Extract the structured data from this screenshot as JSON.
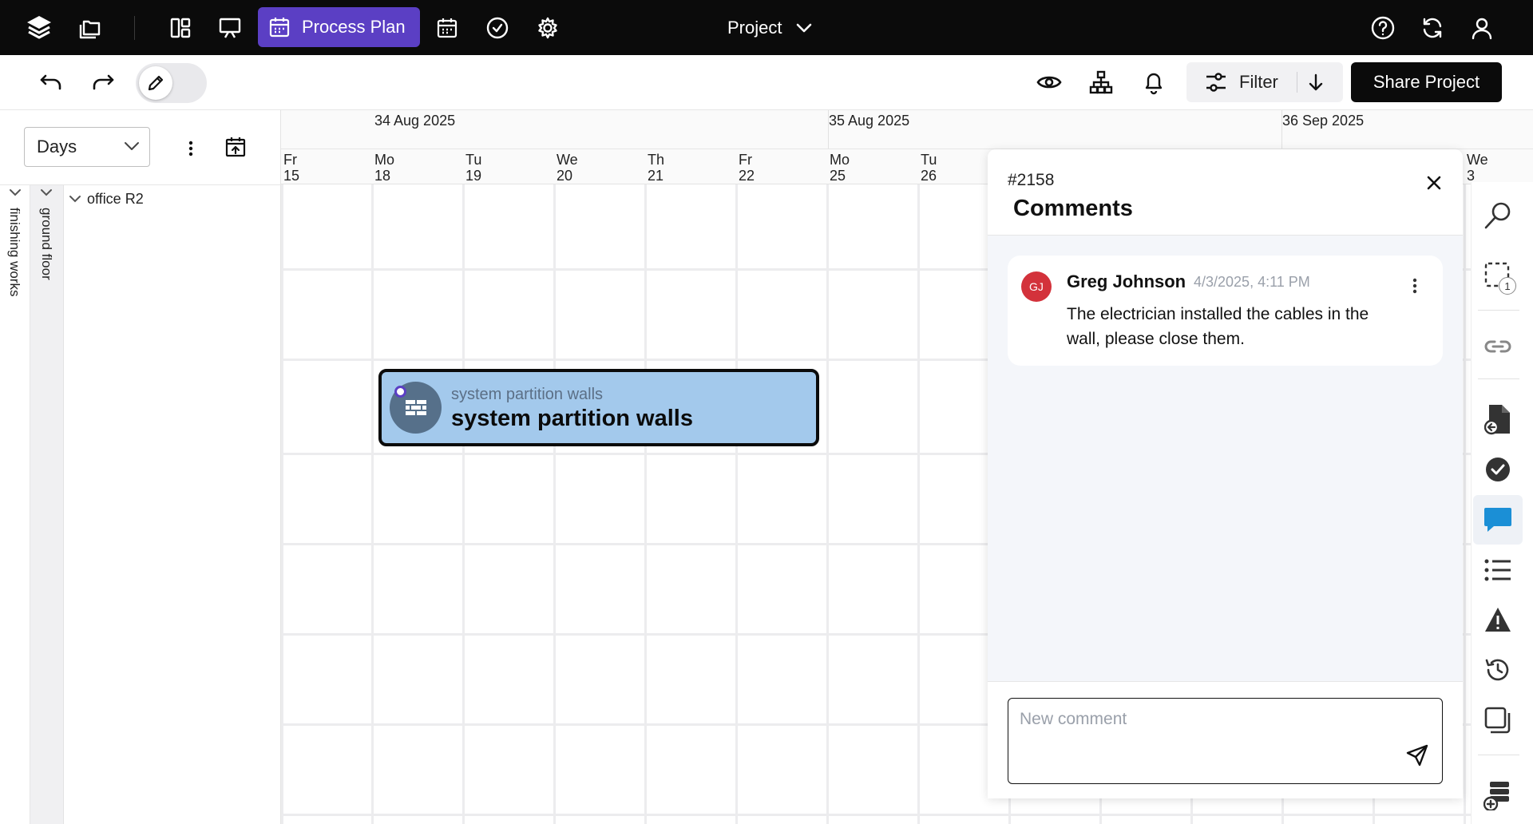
{
  "topbar": {
    "icons": [
      "layers-icon",
      "folders-icon",
      "dashboard-icon",
      "presentation-icon"
    ],
    "active_tab": {
      "label": "Process Plan",
      "icon": "calendar-icon"
    },
    "more_icons": [
      "calendar-icon",
      "check-circle-icon",
      "gear-icon"
    ],
    "project_label": "Project",
    "right_icons": [
      "help-icon",
      "sync-icon",
      "user-icon"
    ],
    "colors": {
      "bar_bg": "#0b0b0b",
      "accent": "#5b3fc4"
    }
  },
  "toolbar": {
    "undo_icon": "undo-icon",
    "redo_icon": "redo-icon",
    "edit_toggle_icon": "pencil-icon",
    "view_icons": [
      "eye-icon",
      "hierarchy-icon",
      "bell-icon"
    ],
    "filter_label": "Filter",
    "share_label": "Share Project"
  },
  "left_panel": {
    "scale_select": {
      "value": "Days"
    },
    "groups": [
      {
        "label": "finishing works"
      },
      {
        "label": "ground floor"
      }
    ],
    "rows": [
      {
        "label": "office R2"
      }
    ]
  },
  "timeline": {
    "months": [
      "34 Aug 2025",
      "35 Aug 2025",
      "36 Sep 2025"
    ],
    "days": [
      {
        "dow": "Fr",
        "num": "15"
      },
      {
        "dow": "Mo",
        "num": "18"
      },
      {
        "dow": "Tu",
        "num": "19"
      },
      {
        "dow": "We",
        "num": "20"
      },
      {
        "dow": "Th",
        "num": "21"
      },
      {
        "dow": "Fr",
        "num": "22"
      },
      {
        "dow": "Mo",
        "num": "25"
      },
      {
        "dow": "Tu",
        "num": "26"
      },
      {
        "dow": "",
        "num": ""
      },
      {
        "dow": "",
        "num": ""
      },
      {
        "dow": "",
        "num": ""
      },
      {
        "dow": "",
        "num": ""
      },
      {
        "dow": "",
        "num": ""
      },
      {
        "dow": "We",
        "num": "3"
      }
    ],
    "task": {
      "category": "system partition walls",
      "title": "system partition walls",
      "icon": "brick-wall-icon",
      "color": "#a3c9ec"
    }
  },
  "comments": {
    "id": "#2158",
    "title": "Comments",
    "items": [
      {
        "initials": "GJ",
        "author": "Greg Johnson",
        "time": "4/3/2025, 4:11 PM",
        "text": "The electrician installed the cables in the wall, please close them.",
        "avatar_color": "#d3323b"
      }
    ],
    "input_placeholder": "New comment"
  },
  "right_rail": {
    "icons": [
      "search-icon",
      "selection-icon",
      "link-icon",
      "document-import-icon",
      "check-circle-icon",
      "comment-icon",
      "list-icon",
      "warning-icon",
      "history-icon",
      "copy-icon",
      "add-database-icon"
    ],
    "selection_badge": "1",
    "active": "comment-icon"
  }
}
